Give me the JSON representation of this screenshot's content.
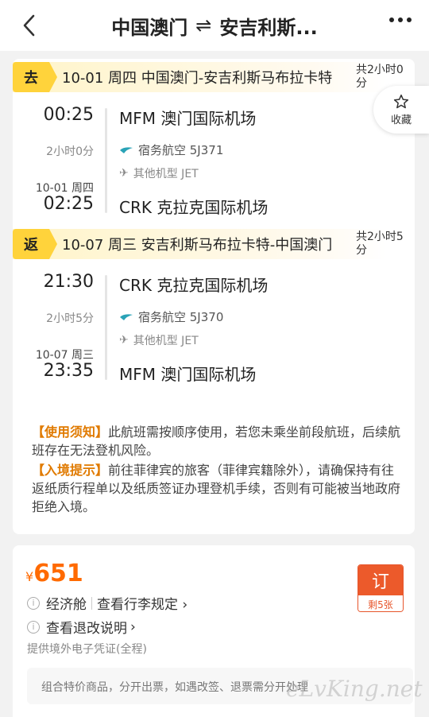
{
  "header": {
    "from": "中国澳门",
    "arrow": "⇌",
    "to": "安吉利斯..."
  },
  "favorite": {
    "label": "收藏"
  },
  "outbound": {
    "tag": "去",
    "summary": "10-01 周四 中国澳门-安吉利斯马布拉卡特",
    "total": "共2小时0分",
    "dep_time": "00:25",
    "dep_airport": "MFM 澳门国际机场",
    "duration": "2小时0分",
    "airline": "宿务航空 5J371",
    "aircraft": "其他机型 JET",
    "arr_date": "10-01 周四",
    "arr_time": "02:25",
    "arr_airport": "CRK 克拉克国际机场"
  },
  "return": {
    "tag": "返",
    "summary": "10-07 周三 安吉利斯马布拉卡特-中国澳门",
    "total": "共2小时5分",
    "dep_time": "21:30",
    "dep_airport": "CRK 克拉克国际机场",
    "duration": "2小时5分",
    "airline": "宿务航空 5J370",
    "aircraft": "其他机型 JET",
    "arr_date": "10-07 周三",
    "arr_time": "23:35",
    "arr_airport": "MFM 澳门国际机场"
  },
  "notice": {
    "usage_key": "【使用须知】",
    "usage_text": "此航班需按顺序使用，若您未乘坐前段航班，后续航班存在无法登机风险。",
    "entry_key": "【入境提示】",
    "entry_text": "前往菲律宾的旅客（菲律宾籍除外），请确保持有往返纸质行程单以及纸质签证办理登机手续，否则有可能被当地政府拒绝入境。"
  },
  "offer": {
    "currency": "¥",
    "price": "651",
    "cabin": "经济舱",
    "baggage_link": "查看行李规定",
    "refund_link": "查看退改说明",
    "eticket": "提供境外电子凭证(全程)",
    "combo_note": "组合特价商品，分开出票，如遇改签、退票需分开处理",
    "book_label": "订",
    "remaining": "剩5张"
  },
  "watermark": "eLvKing.net",
  "colors": {
    "accent": "#ff6a00",
    "tag": "#ffd33b",
    "book": "#ec5a2b"
  }
}
